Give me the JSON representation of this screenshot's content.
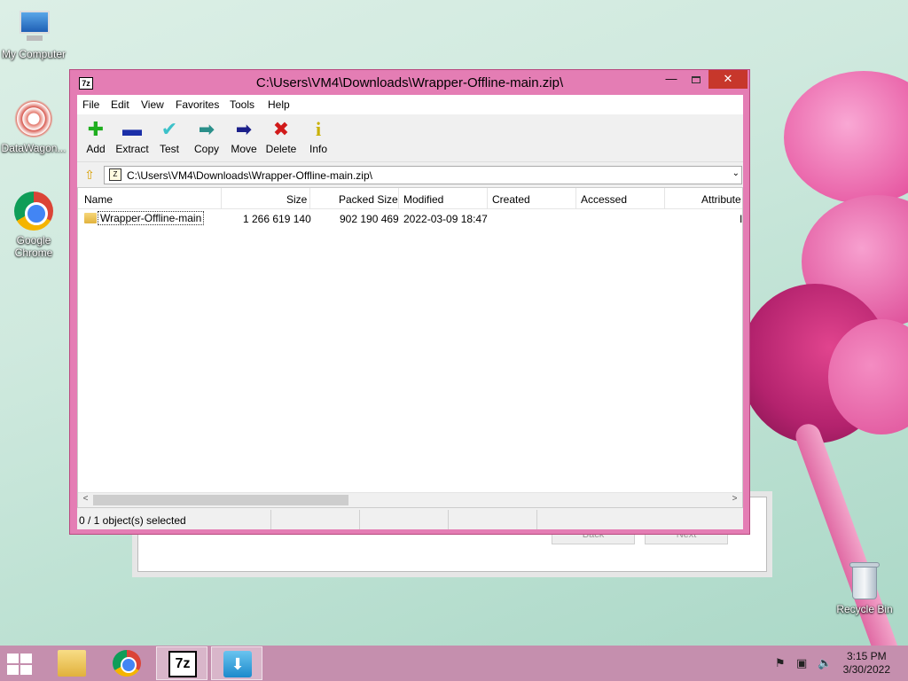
{
  "desktop": {
    "icons": [
      {
        "label": "My Computer"
      },
      {
        "label": "DataWagon..."
      },
      {
        "label": "Google Chrome"
      },
      {
        "label": "Recycle Bin"
      }
    ]
  },
  "window": {
    "app_icon_text": "7z",
    "title": "C:\\Users\\VM4\\Downloads\\Wrapper-Offline-main.zip\\",
    "minimize_glyph": "—",
    "close_glyph": "✕"
  },
  "menu": {
    "items": [
      "File",
      "Edit",
      "View",
      "Favorites",
      "Tools",
      "Help"
    ]
  },
  "toolbar": {
    "buttons": [
      {
        "label": "Add",
        "icon": "✚",
        "color": "#1fae1f"
      },
      {
        "label": "Extract",
        "icon": "▬",
        "color": "#1b2fa8"
      },
      {
        "label": "Test",
        "icon": "✔",
        "color": "#3cc1c9"
      },
      {
        "label": "Copy",
        "icon": "➡",
        "color": "#2a8f8a"
      },
      {
        "label": "Move",
        "icon": "➡",
        "color": "#1b1f8a"
      },
      {
        "label": "Delete",
        "icon": "✖",
        "color": "#d11a1a"
      },
      {
        "label": "Info",
        "icon": "i",
        "color": "#c9b000"
      }
    ]
  },
  "address": {
    "up_glyph": "⇧",
    "icon_text": "Z",
    "path": "C:\\Users\\VM4\\Downloads\\Wrapper-Offline-main.zip\\",
    "dropdown_glyph": "⌄"
  },
  "list": {
    "columns": [
      "Name",
      "Size",
      "Packed Size",
      "Modified",
      "Created",
      "Accessed",
      "Attribute"
    ],
    "rows": [
      {
        "name": "Wrapper-Offline-main",
        "size": "1 266 619 140",
        "packed_size": "902 190 469",
        "modified": "2022-03-09 18:47",
        "created": "",
        "accessed": "",
        "attributes": "I"
      }
    ],
    "scroll_left_glyph": "<",
    "scroll_right_glyph": ">"
  },
  "status": {
    "selection": "0 / 1 object(s) selected"
  },
  "background_dialog": {
    "button1": "Back",
    "button2": "Next"
  },
  "taskbar": {
    "clock_time": "3:15 PM",
    "clock_date": "3/30/2022"
  },
  "colors": {
    "window_frame": "#e47db4",
    "close_button": "#c7372b",
    "taskbar": "#c58fae"
  }
}
